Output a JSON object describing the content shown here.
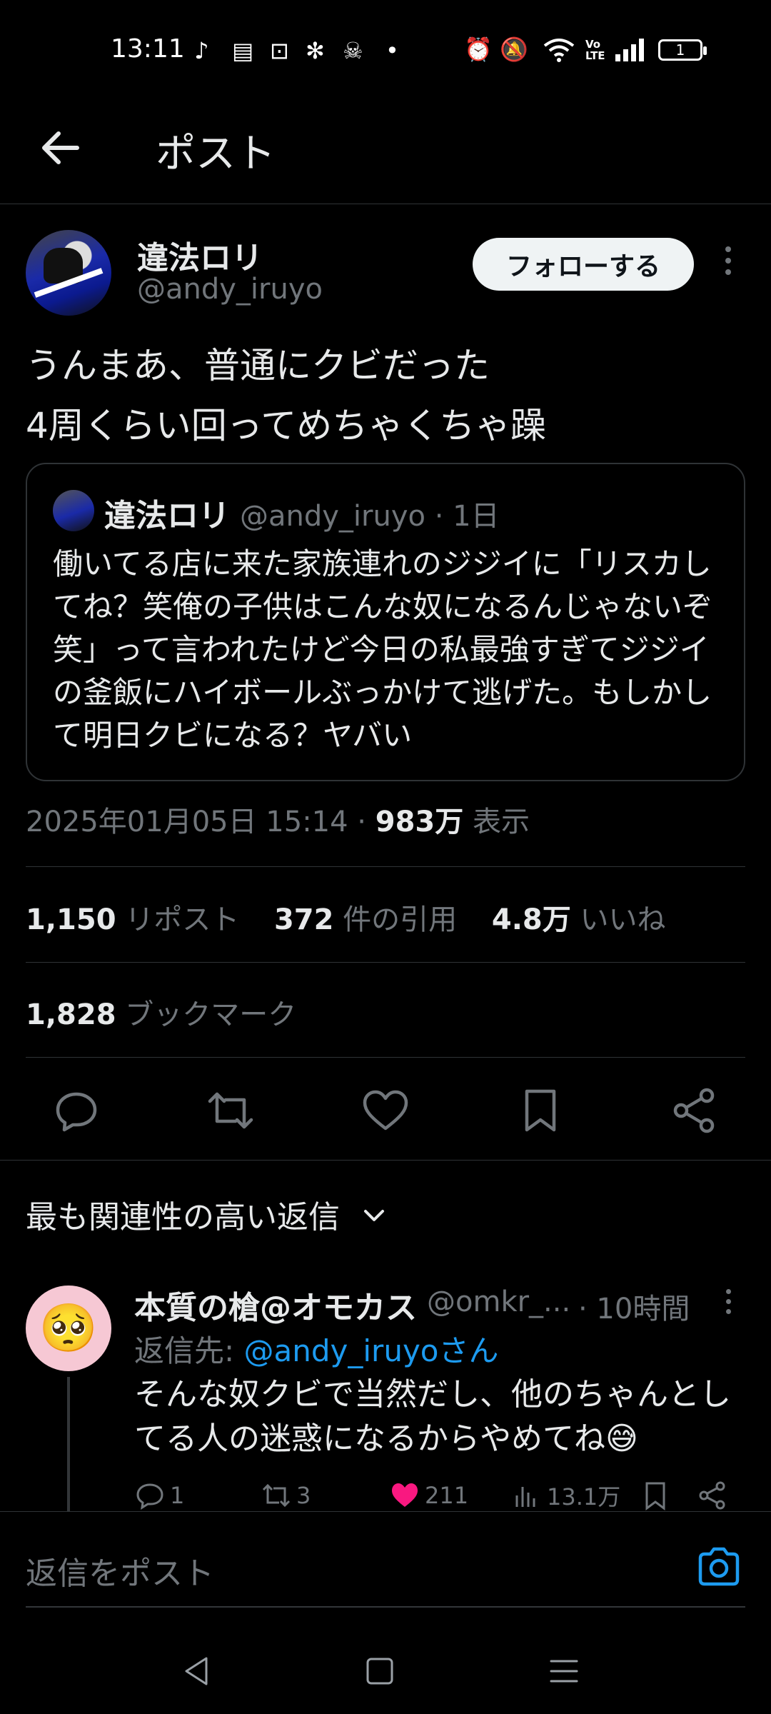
{
  "status_bar": {
    "time": "13:11",
    "notification_icons": [
      "tiktok-icon",
      "news-icon",
      "bus-alert-icon",
      "pinwheel-icon",
      "skull-icon",
      "dot-icon"
    ],
    "system_icons": [
      "alarm-icon",
      "mute-icon",
      "wifi-icon",
      "volte-icon",
      "signal-icon"
    ],
    "battery": "1"
  },
  "header": {
    "title": "ポスト"
  },
  "post": {
    "author_name": "違法ロリ",
    "author_handle": "@andy_iruyo",
    "follow_label": "フォローする",
    "text_line1": "うんまあ、普通にクビだった",
    "text_line2": "4周くらい回ってめちゃくちゃ躁",
    "quote": {
      "name": "違法ロリ",
      "handle_time": "@andy_iruyo · 1日",
      "text": "働いてる店に来た家族連れのジジイに「リスカしてね？笑俺の子供はこんな奴になるんじゃないぞ笑」って言われたけど今日の私最強すぎてジジイの釜飯にハイボールぶっかけて逃げた。もしかして明日クビになる？ヤバい"
    },
    "datetime": "2025年01月05日 15:14 · ",
    "views_count": "983万",
    "views_label": " 表示",
    "reposts_count": "1,150",
    "reposts_label": " リポスト",
    "quotes_count": "372",
    "quotes_label": " 件の引用",
    "likes_count": "4.8万",
    "likes_label": " いいね",
    "bookmarks_count": "1,828",
    "bookmarks_label": " ブックマーク"
  },
  "sort": {
    "label": "最も関連性の高い返信"
  },
  "reply": {
    "avatar_emoji": "🥺",
    "name": "本質の槍@オモカス",
    "handle": "@omkr_...",
    "time": "· 10時間",
    "replying_prefix": "返信先: ",
    "replying_to": "@andy_iruyoさん",
    "text": "そんな奴クビで当然だし、他のちゃんとしてる人の迷惑になるからやめてね😅",
    "replies": "1",
    "reposts": "3",
    "likes": "211",
    "views": "13.1万"
  },
  "composer": {
    "placeholder": "返信をポスト"
  },
  "colors": {
    "background": "#000000",
    "accent": "#1d9bf0",
    "like": "#f91880",
    "muted": "#71767b"
  }
}
